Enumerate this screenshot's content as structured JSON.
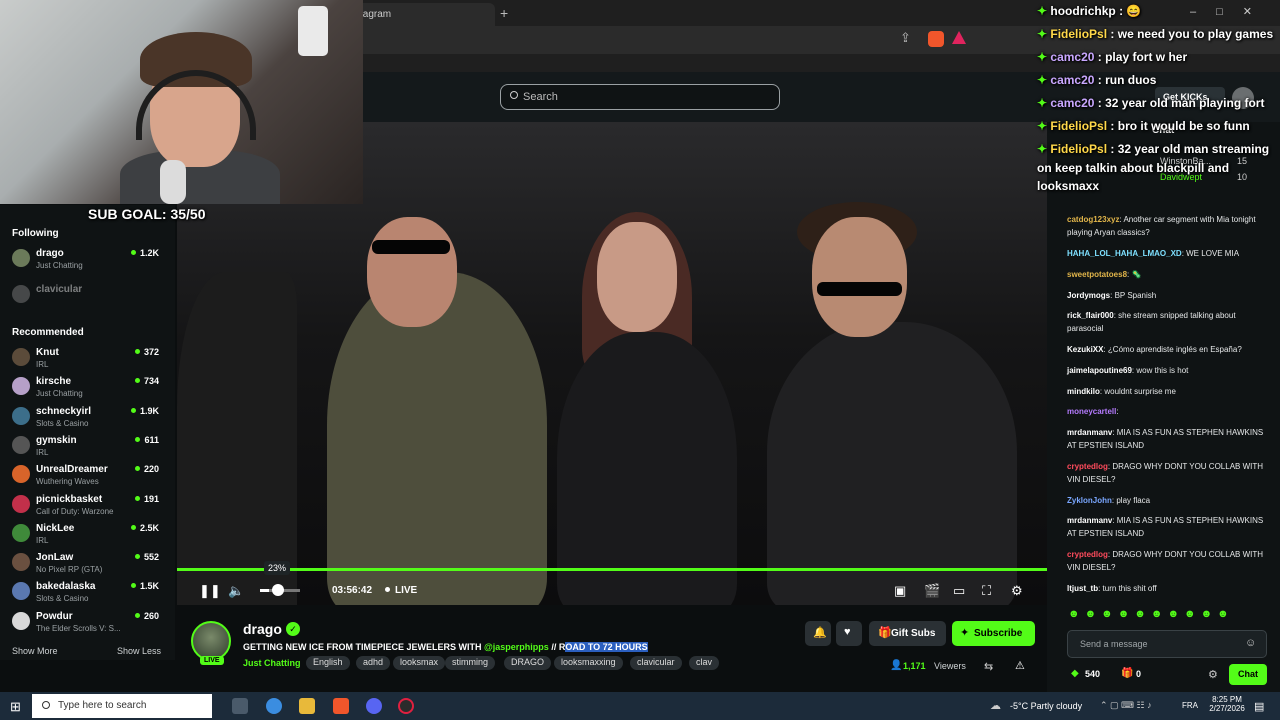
{
  "browser": {
    "tab_title": "tagram",
    "new_tab": "+"
  },
  "header": {
    "search_placeholder": "Search",
    "get_kicks": "Get KICKs"
  },
  "overlay": {
    "sub_goal": "SUB GOAL: 35/50",
    "chat": [
      {
        "user": "hoodrichkp",
        "text": " : 😄"
      },
      {
        "user": "FidelioPsl",
        "text": " : we need you to play games"
      },
      {
        "user": "camc20",
        "text": " : play fort w her"
      },
      {
        "user": "camc20",
        "text": " : run duos"
      },
      {
        "user": "camc20",
        "text": " : 32 year old man playing fort"
      },
      {
        "user": "FidelioPsl",
        "text": " : bro it would be so funn"
      },
      {
        "user": "FidelioPsl",
        "text": " : 32 year old man streaming"
      },
      {
        "user": "",
        "text": "on keep talkin about blackpill and"
      },
      {
        "user": "",
        "text": "looksmaxx"
      }
    ]
  },
  "sidebar": {
    "following_heading": "Following",
    "following": [
      {
        "name": "drago",
        "game": "Just Chatting",
        "viewers": "1.2K",
        "avatar": "#6b7a5a"
      },
      {
        "name": "clavicular",
        "game": "",
        "viewers": "",
        "avatar": "#8a8a8a"
      }
    ],
    "recommended_heading": "Recommended",
    "recommended": [
      {
        "name": "Knut",
        "game": "IRL",
        "viewers": "372",
        "avatar": "#5b4b3a"
      },
      {
        "name": "kirsche",
        "game": "Just Chatting",
        "viewers": "734",
        "avatar": "#b6a0c8"
      },
      {
        "name": "schneckyirl",
        "game": "Slots & Casino",
        "viewers": "1.9K",
        "avatar": "#3c6e8a"
      },
      {
        "name": "gymskin",
        "game": "IRL",
        "viewers": "611",
        "avatar": "#555555"
      },
      {
        "name": "UnrealDreamer",
        "game": "Wuthering Waves",
        "viewers": "220",
        "avatar": "#d8642a"
      },
      {
        "name": "picnickbasket",
        "game": "Call of Duty: Warzone",
        "viewers": "191",
        "avatar": "#c2304a"
      },
      {
        "name": "NickLee",
        "game": "IRL",
        "viewers": "2.5K",
        "avatar": "#3f8a3a"
      },
      {
        "name": "JonLaw",
        "game": "No Pixel RP (GTA)",
        "viewers": "552",
        "avatar": "#6a5040"
      },
      {
        "name": "bakedalaska",
        "game": "Slots & Casino",
        "viewers": "1.5K",
        "avatar": "#5a78b0"
      },
      {
        "name": "Powdur",
        "game": "The Elder Scrolls V: S...",
        "viewers": "260",
        "avatar": "#d8d8d8"
      }
    ],
    "show_more": "Show More",
    "show_less": "Show Less"
  },
  "player": {
    "progress": 1.0,
    "volume_tooltip": "23%",
    "volume_level": 0.23,
    "time": "03:56:42",
    "live_label": "LIVE"
  },
  "stream": {
    "streamer": "drago",
    "live_badge": "LIVE",
    "title_pre": "GETTING NEW ICE FROM TIMEPIECE JEWELERS WITH ",
    "title_mention": "@jasperphipps",
    "title_mid": " // R",
    "title_hl": "OAD TO 72 HOURS",
    "category": "Just Chatting",
    "tags": [
      "English",
      "adhd",
      "looksmax",
      "stimming",
      "DRAGO",
      "looksmaxxing",
      "clavicular",
      "clav"
    ],
    "gift_subs": "Gift Subs",
    "subscribe": "Subscribe",
    "viewers": "1,171",
    "viewers_label": "Viewers"
  },
  "chat": {
    "label": "Chat",
    "leaderboard": [
      {
        "name": "WinstonBa...",
        "value": "15"
      },
      {
        "name": "Davidwept",
        "value": "10"
      }
    ],
    "messages": [
      {
        "user": "catdog123xyz",
        "text": ": Another car segment with Mia tonight playing Aryan classics?",
        "color": "#e1b54a"
      },
      {
        "user": "HAHA_LOL_HAHA_LMAO_XD",
        "text": ": WE LOVE MIA",
        "color": "#7ee0ff"
      },
      {
        "user": "sweetpotatoes8",
        "text": ": 🦠",
        "color": "#e1b54a"
      },
      {
        "user": "Jordymogs",
        "text": ": BP Spanish",
        "color": "#ffffff"
      },
      {
        "user": "rick_flair000",
        "text": ": she stream snipped talking about parasocial",
        "color": "#ffffff"
      },
      {
        "user": "KezukiXX",
        "text": ": ¿Cómo aprendiste inglés en España?",
        "color": "#ffffff"
      },
      {
        "user": "jaimelapoutine69",
        "text": ": wow this is hot",
        "color": "#ffffff"
      },
      {
        "user": "mindkilo",
        "text": ": wouldnt surprise me",
        "color": "#ffffff"
      },
      {
        "user": "moneycartell",
        "text": ":",
        "color": "#b57bff"
      },
      {
        "user": "mrdanmanv",
        "text": ": MIA IS AS FUN AS STEPHEN HAWKINS AT EPSTIEN ISLAND",
        "color": "#ffffff"
      },
      {
        "user": "cryptedlog",
        "text": ": DRAGO WHY DONT YOU COLLAB WITH VIN DIESEL?",
        "color": "#ff4b5c"
      },
      {
        "user": "ZyklonJohn",
        "text": ": play flaca",
        "color": "#7aa7ff"
      },
      {
        "user": "mrdanmanv",
        "text": ": MIA IS AS FUN AS STEPHEN HAWKINS AT EPSTIEN ISLAND",
        "color": "#ffffff"
      },
      {
        "user": "cryptedlog",
        "text": ": DRAGO WHY DONT YOU COLLAB WITH VIN DIESEL?",
        "color": "#ff4b5c"
      },
      {
        "user": "ltjust_tb",
        "text": ": turn this shit off",
        "color": "#ffffff"
      }
    ],
    "input_placeholder": "Send a message",
    "points": "540",
    "gifts": "0",
    "send_label": "Chat"
  },
  "taskbar": {
    "search_placeholder": "Type here to search",
    "weather": "-5°C  Partly cloudy",
    "lang": "FRA",
    "time": "8:25 PM",
    "date": "2/27/2026"
  }
}
